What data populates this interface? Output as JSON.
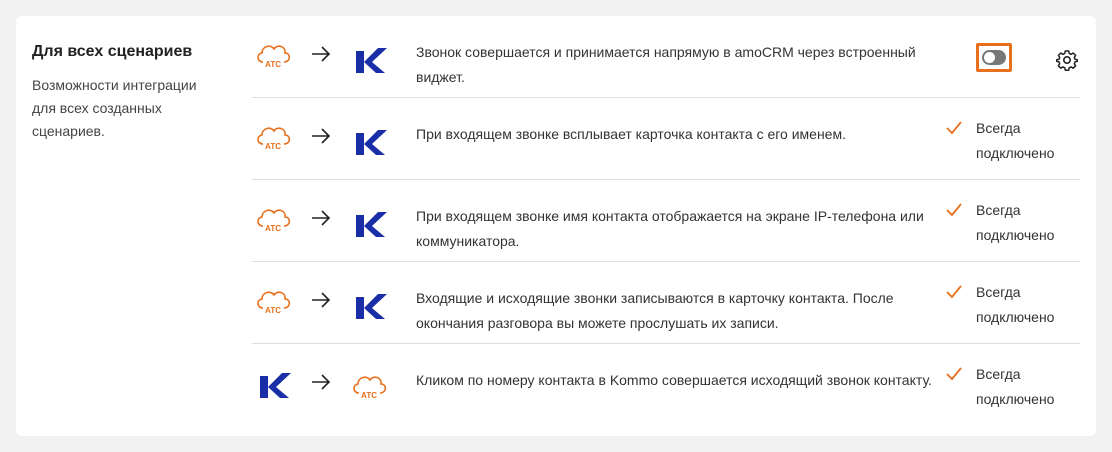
{
  "section": {
    "title": "Для всех сценариев",
    "description": "Возможности интеграции для всех созданных сценариев."
  },
  "colors": {
    "accent": "#e86f1b",
    "brand_blue": "#1a2ea8"
  },
  "icons": {
    "pbx": "cloud-pbx-icon",
    "crm": "kommo-k-icon",
    "arrow": "arrow-right-icon",
    "check": "checkmark-icon",
    "settings": "gear-icon"
  },
  "pbx_label": "АТС",
  "rows": [
    {
      "text": "Звонок совершается и принимается напрямую в amoCRM через встроенный виджет.",
      "from": "pbx",
      "to": "crm",
      "control": "toggle",
      "toggle_on": false
    },
    {
      "text": "При входящем звонке всплывает карточка контакта с его именем.",
      "from": "pbx",
      "to": "crm",
      "status_line1": "Всегда",
      "status_line2": "подключено"
    },
    {
      "text": "При входящем звонке имя контакта отображается на экране IP-телефона или коммуникатора.",
      "from": "pbx",
      "to": "crm",
      "status_line1": "Всегда",
      "status_line2": "подключено"
    },
    {
      "text": "Входящие и исходящие звонки записываются в карточку контакта. После окончания разговора вы можете прослушать их записи.",
      "from": "pbx",
      "to": "crm",
      "status_line1": "Всегда",
      "status_line2": "подключено"
    },
    {
      "text": "Кликом по номеру контакта в Kommo совершается исходящий звонок контакту.",
      "from": "crm",
      "to": "pbx",
      "status_line1": "Всегда",
      "status_line2": "подключено"
    }
  ]
}
